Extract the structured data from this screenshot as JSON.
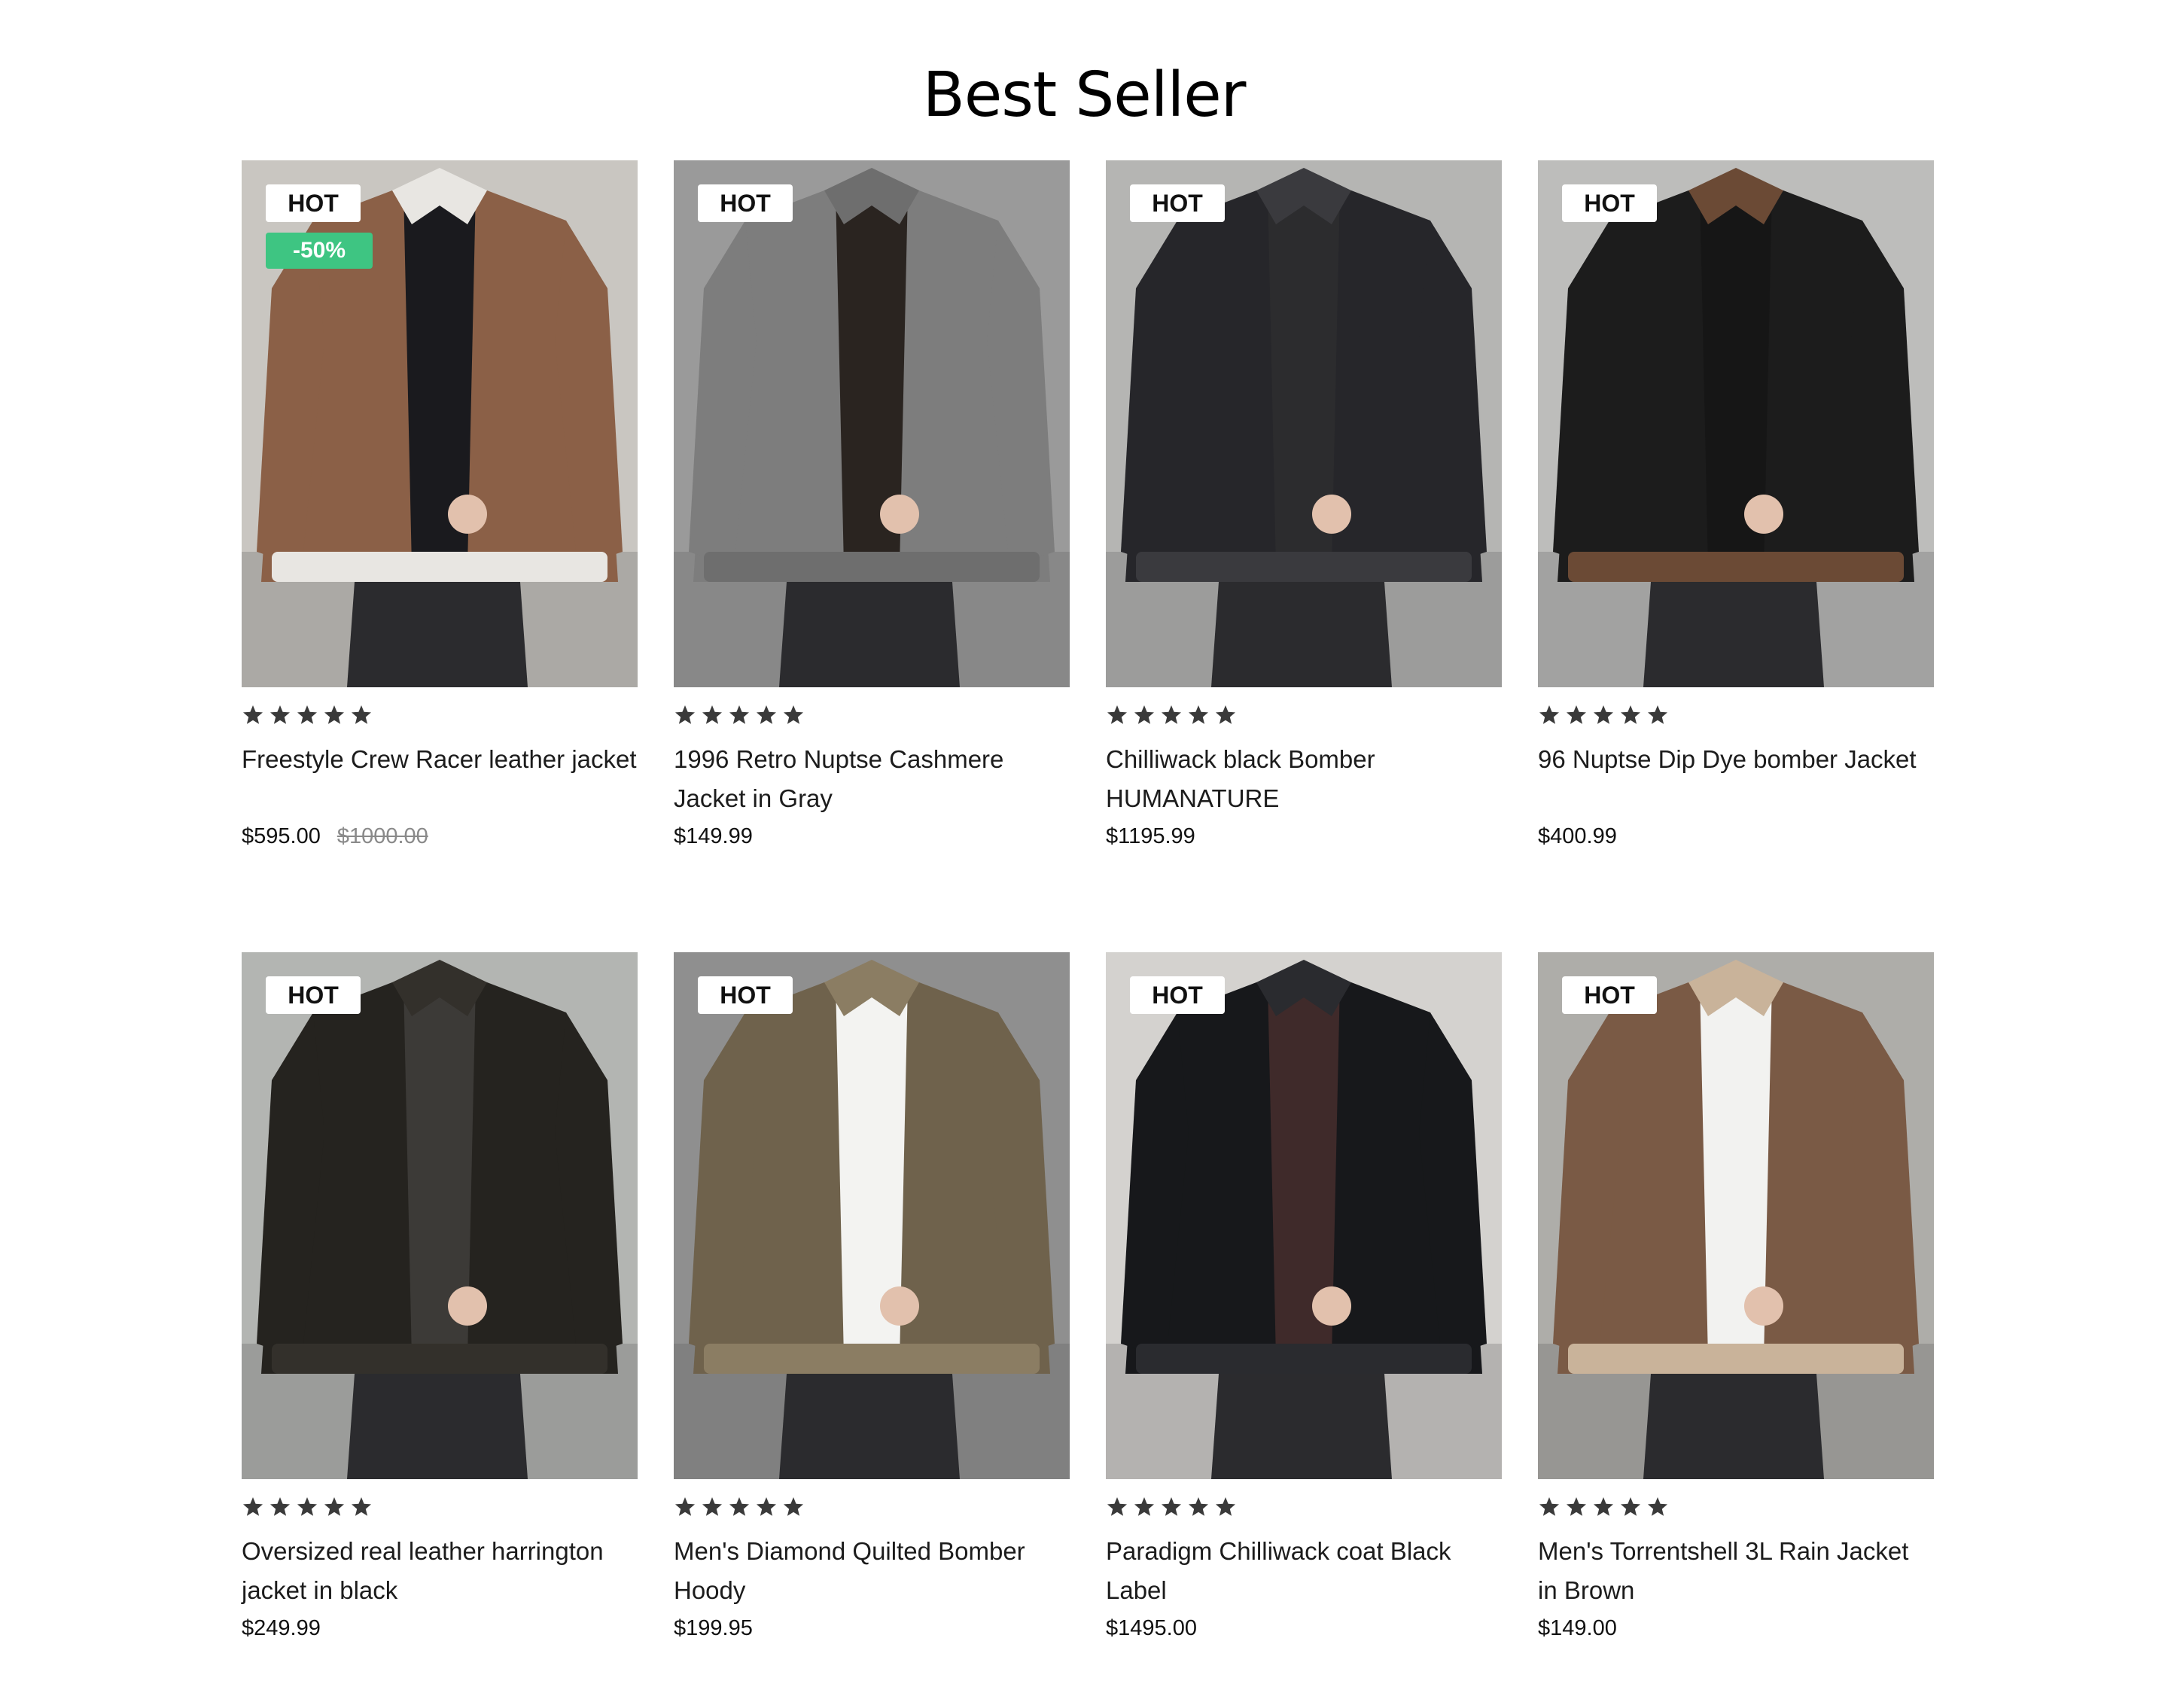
{
  "section": {
    "title": "Best Seller"
  },
  "badges": {
    "hot": "HOT"
  },
  "products": [
    {
      "name": "Freestyle Crew Racer leather jacket",
      "price": "$595.00",
      "old_price": "$1000.00",
      "sale": "-50%",
      "rating": 5,
      "bg": "#c9c6c1",
      "garment": "#8b6047",
      "accent": "#e8e6e2",
      "inner": "#1a1a1e"
    },
    {
      "name": "1996 Retro Nuptse Cashmere Jacket in Gray",
      "price": "$149.99",
      "old_price": "",
      "sale": "",
      "rating": 5,
      "bg": "#9a9a9a",
      "garment": "#7d7d7d",
      "accent": "#6e6e6e",
      "inner": "#2a2420"
    },
    {
      "name": "Chilliwack black Bomber HUMANATURE",
      "price": "$1195.99",
      "old_price": "",
      "sale": "",
      "rating": 5,
      "bg": "#b5b5b3",
      "garment": "#26262a",
      "accent": "#3a3a3e",
      "inner": "#2c2c2e"
    },
    {
      "name": "96 Nuptse Dip Dye bomber Jacket",
      "price": "$400.99",
      "old_price": "",
      "sale": "",
      "rating": 5,
      "bg": "#bdbdbb",
      "garment": "#1c1c1c",
      "accent": "#6b4a35",
      "inner": "#161616"
    },
    {
      "name": "Oversized real leather harrington jacket in black",
      "price": "$249.99",
      "old_price": "",
      "sale": "",
      "rating": 5,
      "bg": "#b3b5b2",
      "garment": "#25231f",
      "accent": "#33302b",
      "inner": "#3c3a37"
    },
    {
      "name": "Men's Diamond Quilted Bomber Hoody",
      "price": "$199.95",
      "old_price": "",
      "sale": "",
      "rating": 5,
      "bg": "#8f8f8f",
      "garment": "#6f624c",
      "accent": "#8b7d63",
      "inner": "#f3f3f1"
    },
    {
      "name": "Paradigm Chilliwack coat Black Label",
      "price": "$1495.00",
      "old_price": "",
      "sale": "",
      "rating": 5,
      "bg": "#d4d2cf",
      "garment": "#17181b",
      "accent": "#2a2b2f",
      "inner": "#3f2a2a"
    },
    {
      "name": "Men's Torrentshell 3L Rain Jacket in Brown",
      "price": "$149.00",
      "old_price": "",
      "sale": "",
      "rating": 5,
      "bg": "#aeada9",
      "garment": "#7a5a45",
      "accent": "#c9b39a",
      "inner": "#f2f2f0"
    }
  ]
}
